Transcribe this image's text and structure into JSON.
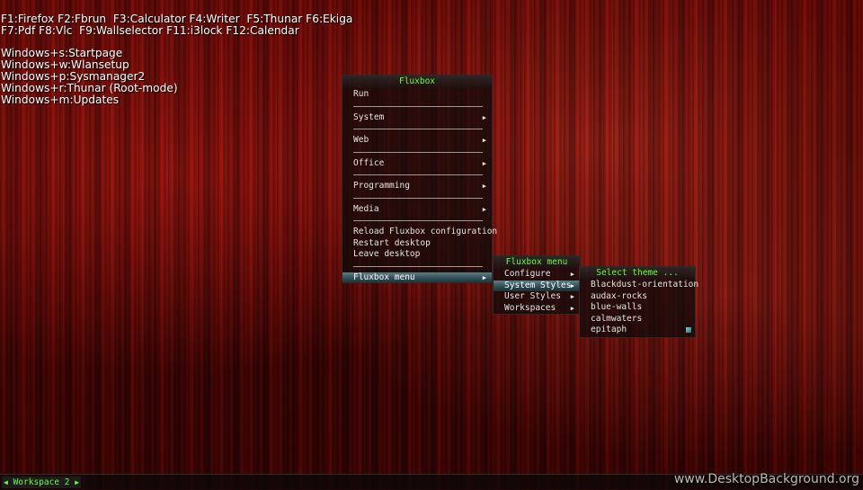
{
  "conky": {
    "lines": [
      "F1:Firefox F2:Fbrun  F3:Calculator F4:Writer  F5:Thunar F6:Ekiga",
      "F7:Pdf F8:Vlc  F9:Wallselector F11:i3lock F12:Calendar",
      "Windows+s:Startpage",
      "Windows+w:Wlansetup",
      "Windows+p:Sysmanager2",
      "Windows+r:Thunar (Root-mode)",
      "Windows+m:Updates"
    ]
  },
  "main_menu": {
    "title": "Fluxbox",
    "items": {
      "run": "Run",
      "system": "System",
      "web": "Web",
      "office": "Office",
      "programming": "Programming",
      "media": "Media",
      "reload": "Reload Fluxbox configuration",
      "restart": "Restart desktop",
      "leave": "Leave desktop",
      "fluxbox_menu": "Fluxbox menu"
    },
    "arrow": "▶"
  },
  "fluxbox_menu": {
    "title": "Fluxbox menu",
    "items": {
      "configure": "Configure",
      "system_styles": "System Styles",
      "user_styles": "User Styles",
      "workspaces": "Workspaces"
    }
  },
  "styles_menu": {
    "title": "Select theme ...",
    "items": [
      "Blackdust-orientation",
      "audax-rocks",
      "blue-walls",
      "calmwaters",
      "epitaph"
    ]
  },
  "toolbar": {
    "workspace": "Workspace 2",
    "prev_arrow": "◀",
    "next_arrow": "▶"
  },
  "watermark": "www.DesktopBackground.org",
  "colors": {
    "accent_green": "#66ff44",
    "selection": "#3a5a63"
  }
}
